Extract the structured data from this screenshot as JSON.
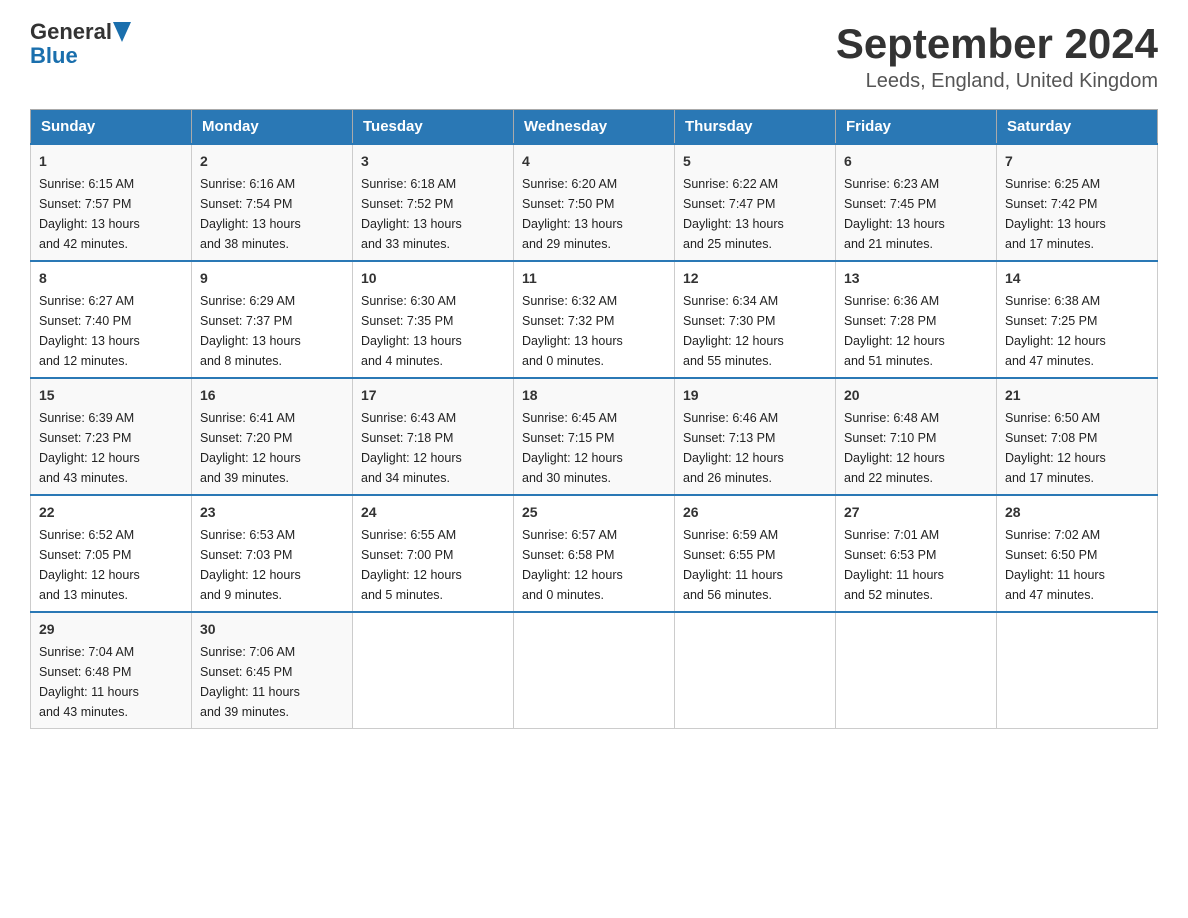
{
  "header": {
    "logo_text_general": "General",
    "logo_text_blue": "Blue",
    "month_title": "September 2024",
    "location": "Leeds, England, United Kingdom"
  },
  "days_of_week": [
    "Sunday",
    "Monday",
    "Tuesday",
    "Wednesday",
    "Thursday",
    "Friday",
    "Saturday"
  ],
  "weeks": [
    [
      {
        "day": "1",
        "sunrise": "6:15 AM",
        "sunset": "7:57 PM",
        "daylight_h": "13",
        "daylight_m": "42"
      },
      {
        "day": "2",
        "sunrise": "6:16 AM",
        "sunset": "7:54 PM",
        "daylight_h": "13",
        "daylight_m": "38"
      },
      {
        "day": "3",
        "sunrise": "6:18 AM",
        "sunset": "7:52 PM",
        "daylight_h": "13",
        "daylight_m": "33"
      },
      {
        "day": "4",
        "sunrise": "6:20 AM",
        "sunset": "7:50 PM",
        "daylight_h": "13",
        "daylight_m": "29"
      },
      {
        "day": "5",
        "sunrise": "6:22 AM",
        "sunset": "7:47 PM",
        "daylight_h": "13",
        "daylight_m": "25"
      },
      {
        "day": "6",
        "sunrise": "6:23 AM",
        "sunset": "7:45 PM",
        "daylight_h": "13",
        "daylight_m": "21"
      },
      {
        "day": "7",
        "sunrise": "6:25 AM",
        "sunset": "7:42 PM",
        "daylight_h": "13",
        "daylight_m": "17"
      }
    ],
    [
      {
        "day": "8",
        "sunrise": "6:27 AM",
        "sunset": "7:40 PM",
        "daylight_h": "13",
        "daylight_m": "12"
      },
      {
        "day": "9",
        "sunrise": "6:29 AM",
        "sunset": "7:37 PM",
        "daylight_h": "13",
        "daylight_m": "8"
      },
      {
        "day": "10",
        "sunrise": "6:30 AM",
        "sunset": "7:35 PM",
        "daylight_h": "13",
        "daylight_m": "4"
      },
      {
        "day": "11",
        "sunrise": "6:32 AM",
        "sunset": "7:32 PM",
        "daylight_h": "13",
        "daylight_m": "0"
      },
      {
        "day": "12",
        "sunrise": "6:34 AM",
        "sunset": "7:30 PM",
        "daylight_h": "12",
        "daylight_m": "55"
      },
      {
        "day": "13",
        "sunrise": "6:36 AM",
        "sunset": "7:28 PM",
        "daylight_h": "12",
        "daylight_m": "51"
      },
      {
        "day": "14",
        "sunrise": "6:38 AM",
        "sunset": "7:25 PM",
        "daylight_h": "12",
        "daylight_m": "47"
      }
    ],
    [
      {
        "day": "15",
        "sunrise": "6:39 AM",
        "sunset": "7:23 PM",
        "daylight_h": "12",
        "daylight_m": "43"
      },
      {
        "day": "16",
        "sunrise": "6:41 AM",
        "sunset": "7:20 PM",
        "daylight_h": "12",
        "daylight_m": "39"
      },
      {
        "day": "17",
        "sunrise": "6:43 AM",
        "sunset": "7:18 PM",
        "daylight_h": "12",
        "daylight_m": "34"
      },
      {
        "day": "18",
        "sunrise": "6:45 AM",
        "sunset": "7:15 PM",
        "daylight_h": "12",
        "daylight_m": "30"
      },
      {
        "day": "19",
        "sunrise": "6:46 AM",
        "sunset": "7:13 PM",
        "daylight_h": "12",
        "daylight_m": "26"
      },
      {
        "day": "20",
        "sunrise": "6:48 AM",
        "sunset": "7:10 PM",
        "daylight_h": "12",
        "daylight_m": "22"
      },
      {
        "day": "21",
        "sunrise": "6:50 AM",
        "sunset": "7:08 PM",
        "daylight_h": "12",
        "daylight_m": "17"
      }
    ],
    [
      {
        "day": "22",
        "sunrise": "6:52 AM",
        "sunset": "7:05 PM",
        "daylight_h": "12",
        "daylight_m": "13"
      },
      {
        "day": "23",
        "sunrise": "6:53 AM",
        "sunset": "7:03 PM",
        "daylight_h": "12",
        "daylight_m": "9"
      },
      {
        "day": "24",
        "sunrise": "6:55 AM",
        "sunset": "7:00 PM",
        "daylight_h": "12",
        "daylight_m": "5"
      },
      {
        "day": "25",
        "sunrise": "6:57 AM",
        "sunset": "6:58 PM",
        "daylight_h": "12",
        "daylight_m": "0"
      },
      {
        "day": "26",
        "sunrise": "6:59 AM",
        "sunset": "6:55 PM",
        "daylight_h": "11",
        "daylight_m": "56"
      },
      {
        "day": "27",
        "sunrise": "7:01 AM",
        "sunset": "6:53 PM",
        "daylight_h": "11",
        "daylight_m": "52"
      },
      {
        "day": "28",
        "sunrise": "7:02 AM",
        "sunset": "6:50 PM",
        "daylight_h": "11",
        "daylight_m": "47"
      }
    ],
    [
      {
        "day": "29",
        "sunrise": "7:04 AM",
        "sunset": "6:48 PM",
        "daylight_h": "11",
        "daylight_m": "43"
      },
      {
        "day": "30",
        "sunrise": "7:06 AM",
        "sunset": "6:45 PM",
        "daylight_h": "11",
        "daylight_m": "39"
      },
      null,
      null,
      null,
      null,
      null
    ]
  ],
  "labels": {
    "sunrise": "Sunrise:",
    "sunset": "Sunset:",
    "daylight": "Daylight:",
    "hours_and": "hours and",
    "minutes": "minutes."
  }
}
